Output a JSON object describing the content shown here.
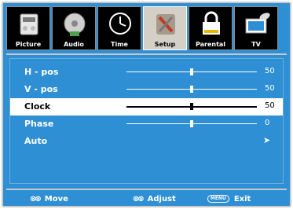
{
  "tabs": [
    {
      "label": "Picture",
      "icon": "picture-icon",
      "active": false
    },
    {
      "label": "Audio",
      "icon": "audio-icon",
      "active": false
    },
    {
      "label": "Time",
      "icon": "clock-icon",
      "active": false
    },
    {
      "label": "Setup",
      "icon": "setup-tools-icon",
      "active": true
    },
    {
      "label": "Parental",
      "icon": "lock-icon",
      "active": false
    },
    {
      "label": "TV",
      "icon": "satellite-tv-icon",
      "active": false
    }
  ],
  "menu": {
    "items": [
      {
        "label": "H - pos",
        "value": "50",
        "level": 0.5,
        "type": "slider",
        "selected": false
      },
      {
        "label": "V - pos",
        "value": "50",
        "level": 0.5,
        "type": "slider",
        "selected": false
      },
      {
        "label": "Clock",
        "value": "50",
        "level": 0.5,
        "type": "slider",
        "selected": true
      },
      {
        "label": "Phase",
        "value": "0",
        "level": 0.5,
        "type": "slider",
        "selected": false
      },
      {
        "label": "Auto",
        "value": "➤",
        "type": "action",
        "selected": false
      }
    ]
  },
  "footer": {
    "move_label": "Move",
    "adjust_label": "Adjust",
    "exit_label": "Exit",
    "menu_key": "MENU",
    "move_glyph": "⊗⊗",
    "adjust_glyph": "⊗⊗"
  },
  "colors": {
    "background": "#2e8fd4",
    "selected_row": "#ffffff",
    "active_tab": "#d4d0c8"
  }
}
